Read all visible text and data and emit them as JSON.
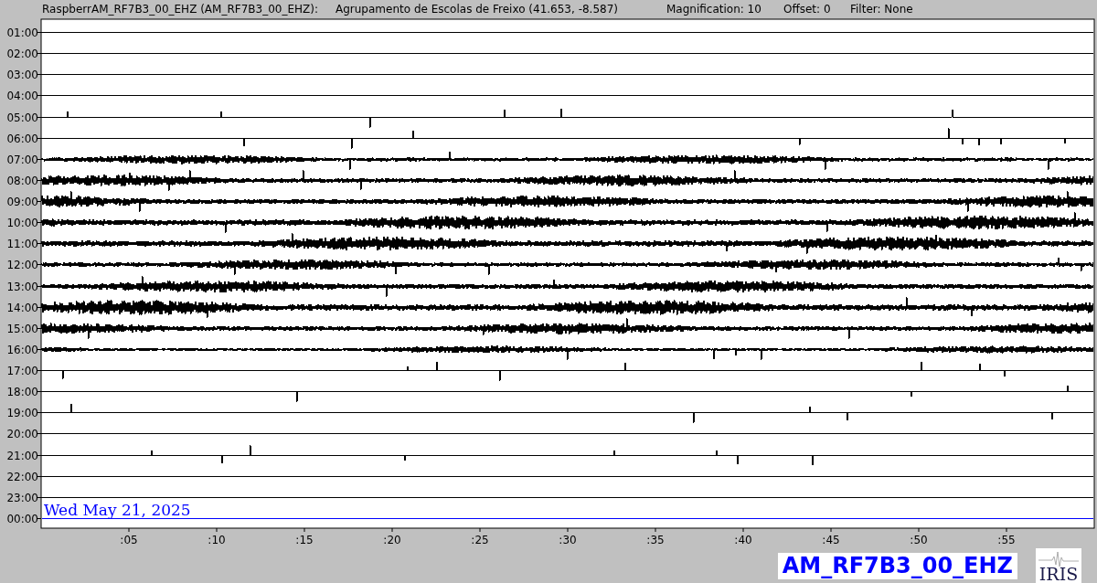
{
  "header": {
    "station": "RaspberrAM_RF7B3_00_EHZ (AM_RF7B3_00_EHZ):",
    "location": "Agrupamento de Escolas de Freixo (41.653, -8.587)",
    "magnification": "Magnification: 10",
    "offset": "Offset: 0",
    "filter": "Filter: None"
  },
  "rows": [
    {
      "label": "01:00",
      "color": "#000000"
    },
    {
      "label": "02:00",
      "color": "#000000"
    },
    {
      "label": "03:00",
      "color": "#000000"
    },
    {
      "label": "04:00",
      "color": "#000000"
    },
    {
      "label": "05:00",
      "color": "#000000"
    },
    {
      "label": "06:00",
      "color": "#000000"
    },
    {
      "label": "07:00",
      "color": "#000000"
    },
    {
      "label": "08:00",
      "color": "#000000"
    },
    {
      "label": "09:00",
      "color": "#000000"
    },
    {
      "label": "10:00",
      "color": "#000000"
    },
    {
      "label": "11:00",
      "color": "#000000"
    },
    {
      "label": "12:00",
      "color": "#000000"
    },
    {
      "label": "13:00",
      "color": "#000000"
    },
    {
      "label": "14:00",
      "color": "#000000"
    },
    {
      "label": "15:00",
      "color": "#000000"
    },
    {
      "label": "16:00",
      "color": "#000000"
    },
    {
      "label": "17:00",
      "color": "#000000"
    },
    {
      "label": "18:00",
      "color": "#000000"
    },
    {
      "label": "19:00",
      "color": "#000000"
    },
    {
      "label": "20:00",
      "color": "#000000"
    },
    {
      "label": "21:00",
      "color": "#000000"
    },
    {
      "label": "22:00",
      "color": "#000000"
    },
    {
      "label": "23:00",
      "color": "#000000"
    },
    {
      "label": "00:00",
      "color": "#0000ff"
    }
  ],
  "minute_ticks": [
    ":05",
    ":10",
    ":15",
    ":20",
    ":25",
    ":30",
    ":35",
    ":40",
    ":45",
    ":50",
    ":55"
  ],
  "date": "Wed May 21, 2025",
  "station_label": "AM_RF7B3_00_EHZ",
  "logo": {
    "text": "IRIS"
  }
}
